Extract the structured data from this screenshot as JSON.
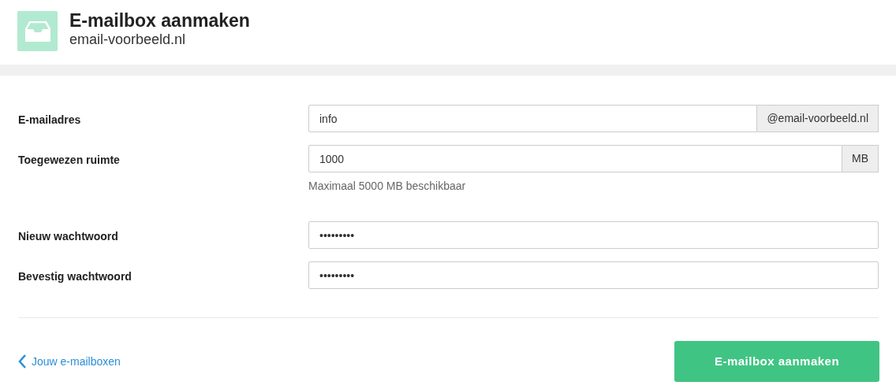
{
  "header": {
    "title": "E-mailbox aanmaken",
    "subtitle": "email-voorbeeld.nl"
  },
  "fields": [
    {
      "label": "E-mailadres",
      "value": "info",
      "addon": "@email-voorbeeld.nl"
    },
    {
      "label": "Toegewezen ruimte",
      "value": "1000",
      "addon": "MB",
      "help": "Maximaal 5000 MB beschikbaar"
    },
    {
      "label": "Nieuw wachtwoord",
      "value": "•••••••••"
    },
    {
      "label": "Bevestig wachtwoord",
      "value": "•••••••••"
    }
  ],
  "back_link": "Jouw e-mailboxen",
  "submit_button": "E-mailbox aanmaken"
}
